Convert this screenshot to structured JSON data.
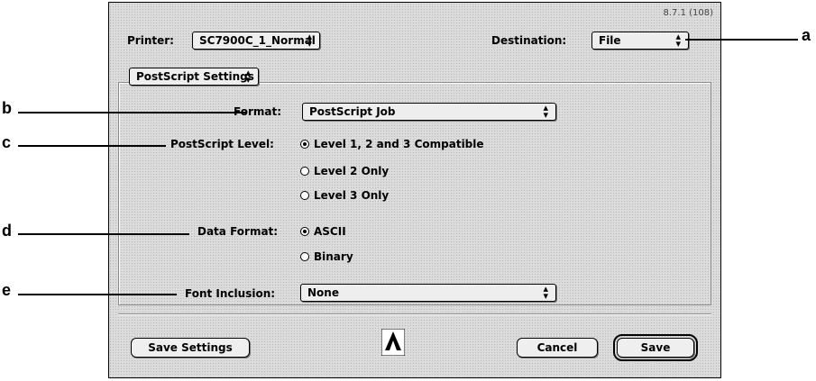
{
  "version": "8.7.1 (108)",
  "printer": {
    "label": "Printer:",
    "value": "SC7900C_1_Normal"
  },
  "destination": {
    "label": "Destination:",
    "value": "File"
  },
  "panel_menu": {
    "value": "PostScript Settings"
  },
  "format": {
    "label": "Format:",
    "value": "PostScript Job"
  },
  "ps_level": {
    "label": "PostScript Level:",
    "options": [
      "Level 1, 2 and 3 Compatible",
      "Level 2 Only",
      "Level 3 Only"
    ],
    "selected": "Level 1, 2 and 3 Compatible"
  },
  "data_format": {
    "label": "Data Format:",
    "options": [
      "ASCII",
      "Binary"
    ],
    "selected": "ASCII"
  },
  "font_inclusion": {
    "label": "Font Inclusion:",
    "value": "None"
  },
  "buttons": {
    "save_settings": "Save Settings",
    "cancel": "Cancel",
    "save": "Save"
  },
  "callouts": [
    "a",
    "b",
    "c",
    "d",
    "e"
  ],
  "icons": {
    "popup_arrows": "updown-arrows-icon",
    "logo": "adobe-logo-icon"
  }
}
